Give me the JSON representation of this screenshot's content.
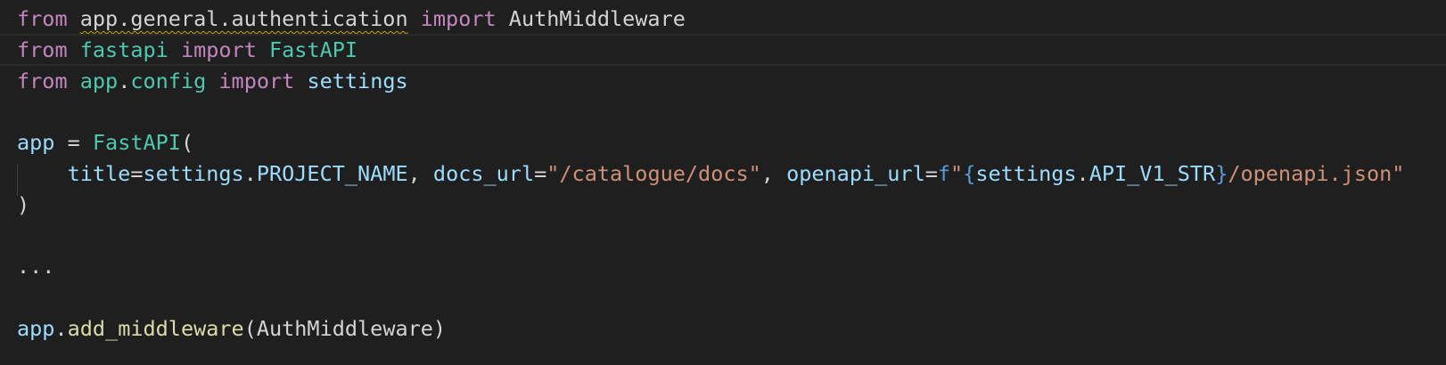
{
  "editor": {
    "lines": [
      {
        "tokens": [
          {
            "text": "from",
            "type": "kw"
          },
          {
            "text": " ",
            "type": "plain"
          },
          {
            "text": "app.general.authentication",
            "type": "plain-squiggle"
          },
          {
            "text": " ",
            "type": "plain"
          },
          {
            "text": "import",
            "type": "kw"
          },
          {
            "text": " AuthMiddleware",
            "type": "plain"
          }
        ]
      },
      {
        "tokens": [
          {
            "text": "from",
            "type": "kw"
          },
          {
            "text": " ",
            "type": "plain"
          },
          {
            "text": "fastapi",
            "type": "mod"
          },
          {
            "text": " ",
            "type": "plain"
          },
          {
            "text": "import",
            "type": "kw"
          },
          {
            "text": " ",
            "type": "plain"
          },
          {
            "text": "FastAPI",
            "type": "class"
          }
        ]
      },
      {
        "tokens": [
          {
            "text": "from",
            "type": "kw"
          },
          {
            "text": " ",
            "type": "plain"
          },
          {
            "text": "app",
            "type": "mod"
          },
          {
            "text": ".",
            "type": "plain"
          },
          {
            "text": "config",
            "type": "mod"
          },
          {
            "text": " ",
            "type": "plain"
          },
          {
            "text": "import",
            "type": "kw"
          },
          {
            "text": " ",
            "type": "plain"
          },
          {
            "text": "settings",
            "type": "var"
          }
        ]
      },
      {
        "tokens": []
      },
      {
        "tokens": [
          {
            "text": "app",
            "type": "var"
          },
          {
            "text": " = ",
            "type": "op"
          },
          {
            "text": "FastAPI",
            "type": "class"
          },
          {
            "text": "(",
            "type": "plain"
          }
        ]
      },
      {
        "tokens": [
          {
            "text": "    ",
            "type": "plain"
          },
          {
            "text": "title",
            "type": "param"
          },
          {
            "text": "=",
            "type": "op"
          },
          {
            "text": "settings",
            "type": "var"
          },
          {
            "text": ".",
            "type": "plain"
          },
          {
            "text": "PROJECT_NAME",
            "type": "var"
          },
          {
            "text": ", ",
            "type": "plain"
          },
          {
            "text": "docs_url",
            "type": "param"
          },
          {
            "text": "=",
            "type": "op"
          },
          {
            "text": "\"/catalogue/docs\"",
            "type": "str"
          },
          {
            "text": ", ",
            "type": "plain"
          },
          {
            "text": "openapi_url",
            "type": "param"
          },
          {
            "text": "=",
            "type": "op"
          },
          {
            "text": "f",
            "type": "fprefix"
          },
          {
            "text": "\"",
            "type": "str"
          },
          {
            "text": "{",
            "type": "brace"
          },
          {
            "text": "settings",
            "type": "var"
          },
          {
            "text": ".",
            "type": "plain"
          },
          {
            "text": "API_V1_STR",
            "type": "var"
          },
          {
            "text": "}",
            "type": "brace"
          },
          {
            "text": "/openapi.json\"",
            "type": "str"
          }
        ]
      },
      {
        "tokens": [
          {
            "text": ")",
            "type": "plain"
          }
        ]
      },
      {
        "tokens": []
      },
      {
        "tokens": [
          {
            "text": "...",
            "type": "plain"
          }
        ]
      },
      {
        "tokens": []
      },
      {
        "tokens": [
          {
            "text": "app",
            "type": "var"
          },
          {
            "text": ".",
            "type": "plain"
          },
          {
            "text": "add_middleware",
            "type": "fn"
          },
          {
            "text": "(AuthMiddleware)",
            "type": "plain"
          }
        ]
      }
    ]
  },
  "colors": {
    "background": "#1f1f1f",
    "keyword": "#c586c0",
    "module": "#4ec9b0",
    "variable": "#9cdcfe",
    "string": "#ce9178",
    "function": "#dcdcaa",
    "warning_squiggle": "#cca700"
  }
}
